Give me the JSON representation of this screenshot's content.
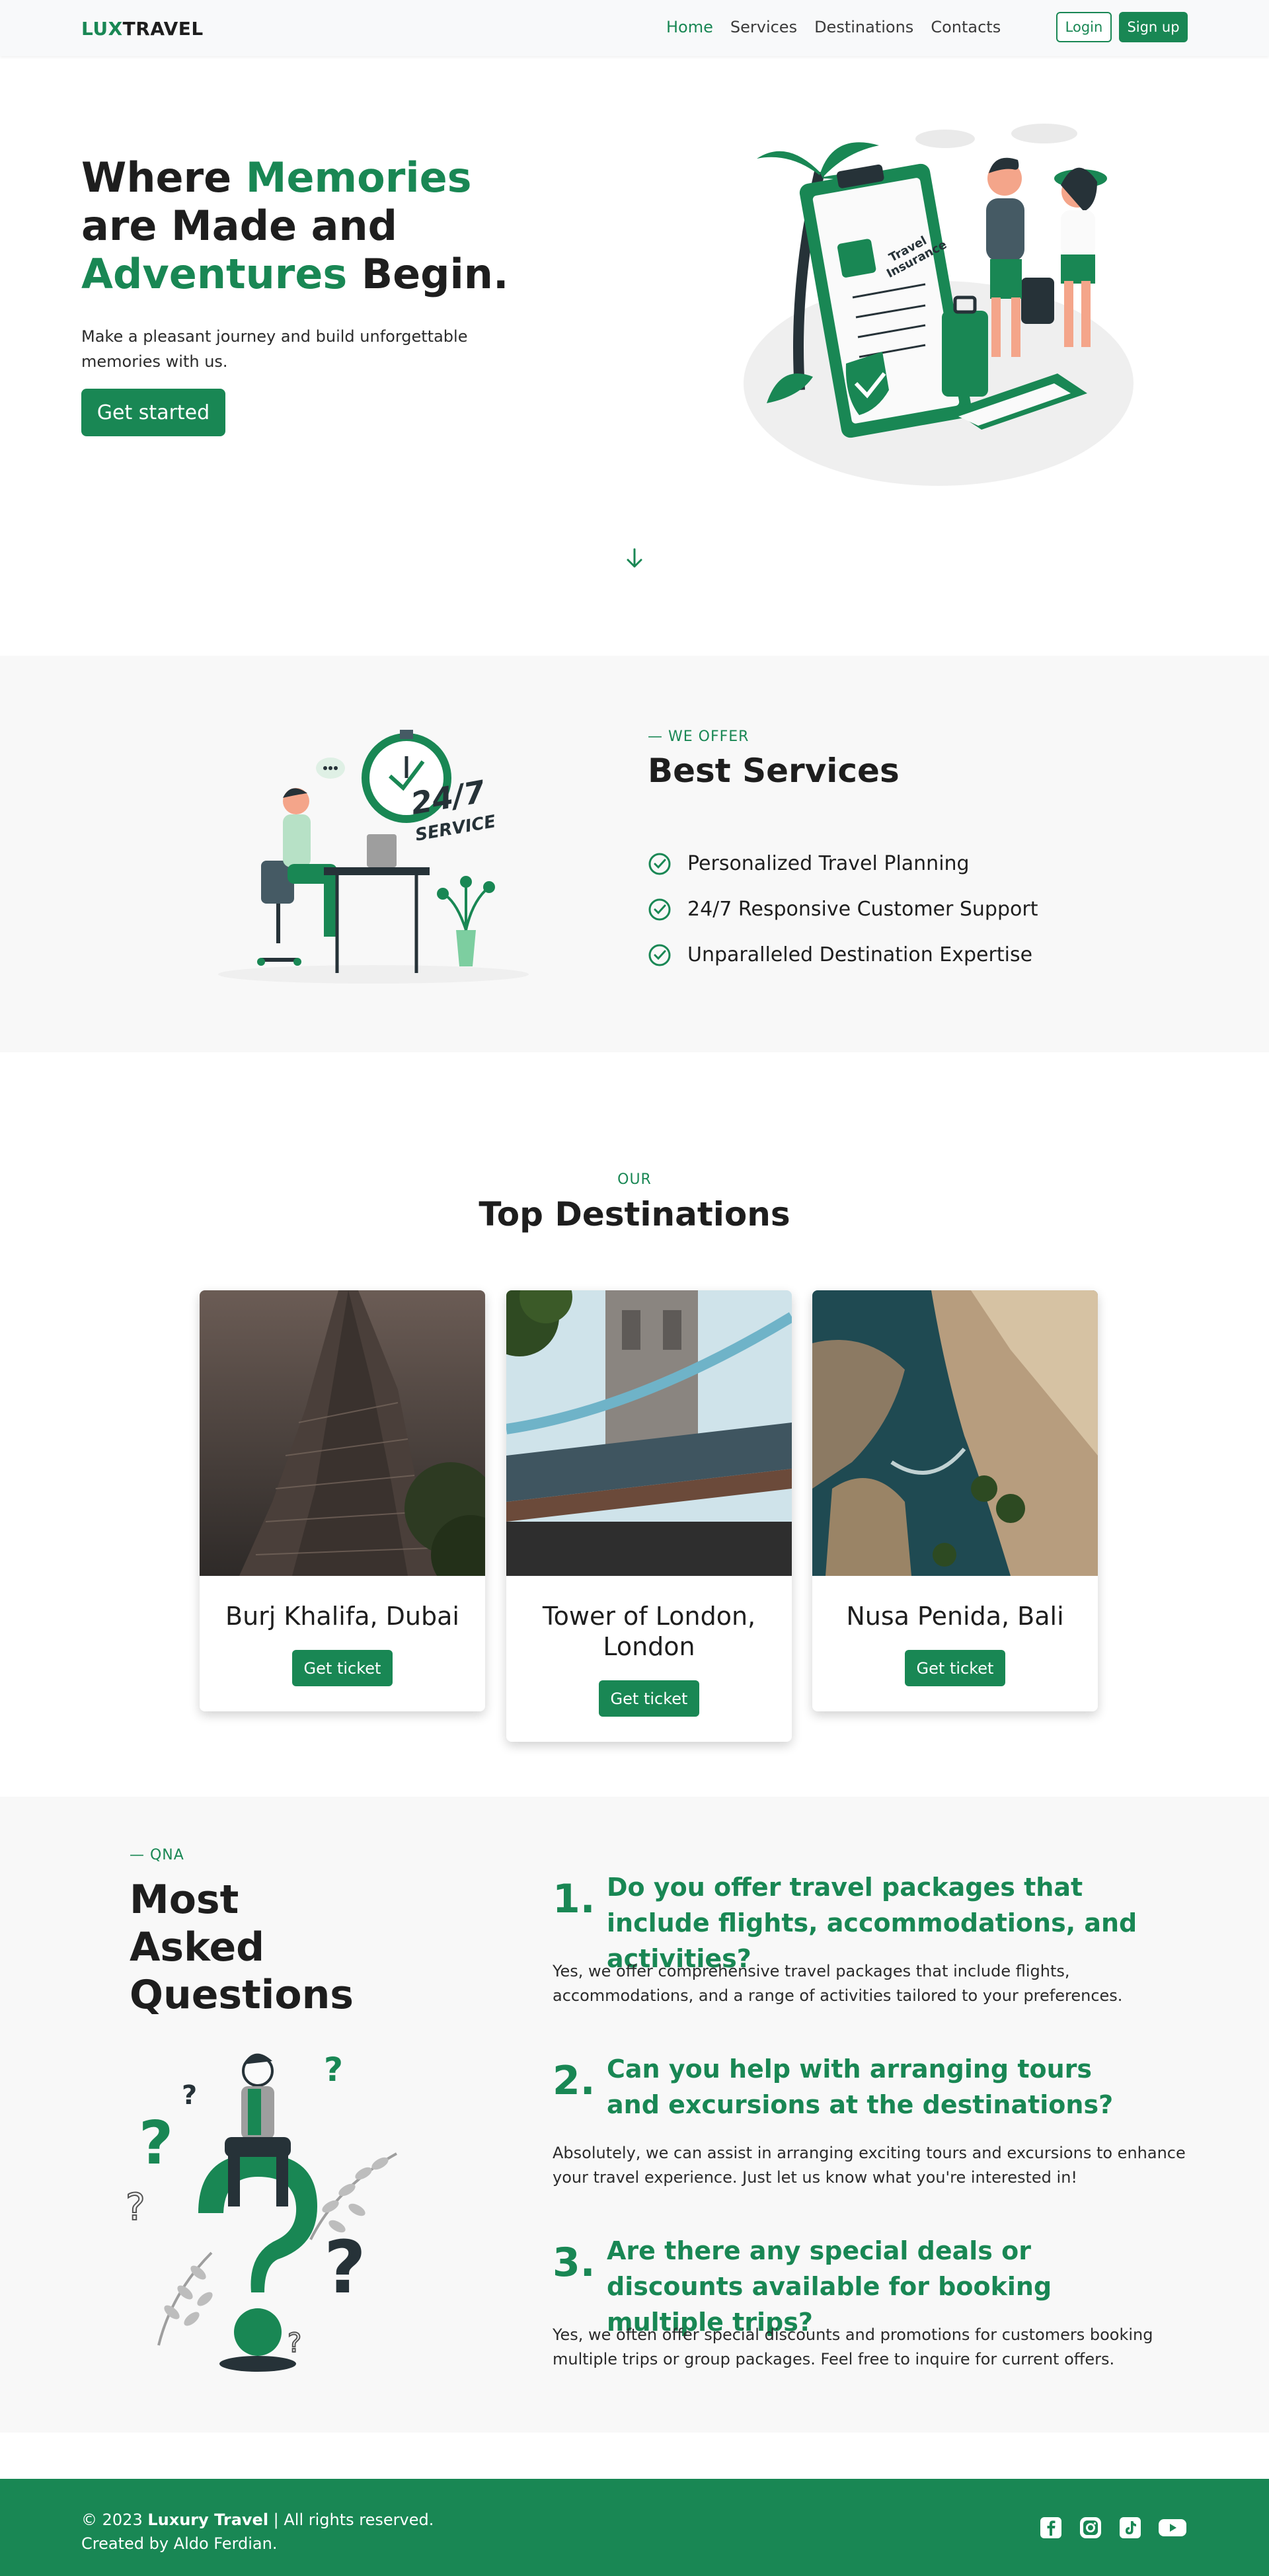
{
  "nav": {
    "brand_lux": "LUX",
    "brand_travel": "TRAVEL",
    "links": [
      "Home",
      "Services",
      "Destinations",
      "Contacts"
    ],
    "login": "Login",
    "signup": "Sign up"
  },
  "hero": {
    "t1": "Where ",
    "t2": "Memories",
    "t3": " are Made and ",
    "t4": "Adventures",
    "t5": " Begin.",
    "subtitle": "Make a pleasant journey and build unforgettable memories with us.",
    "cta": "Get started",
    "illustration_text_1": "Travel",
    "illustration_text_2": "Insurance"
  },
  "services": {
    "eyebrow": "— WE OFFER",
    "title": "Best Services",
    "items": [
      "Personalized Travel Planning",
      "24/7 Responsive Customer Support",
      "Unparalleled Destination Expertise"
    ],
    "badge_main": "24/7",
    "badge_sub": "SERVICE"
  },
  "destinations": {
    "eyebrow": "OUR",
    "title": "Top Destinations",
    "cards": [
      {
        "title": "Burj Khalifa, Dubai",
        "button": "Get ticket"
      },
      {
        "title": "Tower of London, London",
        "button": "Get ticket"
      },
      {
        "title": "Nusa Penida, Bali",
        "button": "Get ticket"
      }
    ]
  },
  "qna": {
    "eyebrow": "— QNA",
    "title": "Most Asked Questions",
    "items": [
      {
        "num": "1.",
        "q": "Do you offer travel packages that include flights, accommodations, and activities?",
        "a": "Yes, we offer comprehensive travel packages that include flights, accommodations, and a range of activities tailored to your preferences."
      },
      {
        "num": "2.",
        "q": "Can you help with arranging tours and excursions at the destinations?",
        "a": "Absolutely, we can assist in arranging exciting tours and excursions to enhance your travel experience. Just let us know what you're interested in!"
      },
      {
        "num": "3.",
        "q": "Are there any special deals or discounts available for booking multiple trips?",
        "a": "Yes, we often offer special discounts and promotions for customers booking multiple trips or group packages. Feel free to inquire for current offers."
      }
    ]
  },
  "footer": {
    "copy_prefix": "© 2023 ",
    "company": "Luxury Travel",
    "copy_suffix": " | All rights reserved.",
    "credit": "Created by Aldo Ferdian."
  },
  "colors": {
    "accent": "#198754",
    "section_bg": "#f8f8f8",
    "text": "#1e1e1e"
  },
  "icons": [
    "arrow-down-icon",
    "check-circle-icon",
    "facebook-icon",
    "instagram-icon",
    "tiktok-icon",
    "youtube-icon"
  ]
}
